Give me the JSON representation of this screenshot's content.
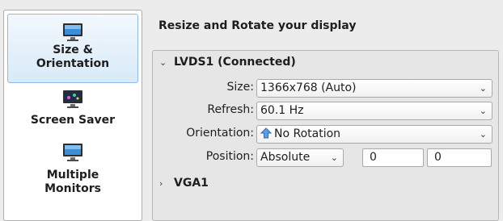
{
  "sidebar": {
    "items": [
      {
        "label_line1": "Size &",
        "label_line2": "Orientation",
        "icon": "monitor-icon"
      },
      {
        "label": "Screen Saver",
        "icon": "monitor-screensaver-icon"
      },
      {
        "label_line1": "Multiple",
        "label_line2": "Monitors",
        "icon": "monitor-icon"
      }
    ],
    "selected_index": 0
  },
  "main": {
    "title": "Resize and Rotate your display",
    "outputs": [
      {
        "name": "LVDS1 (Connected)",
        "expanded": true,
        "size_label": "Size:",
        "size_value": "1366x768 (Auto)",
        "refresh_label": "Refresh:",
        "refresh_value": "60.1 Hz",
        "orientation_label": "Orientation:",
        "orientation_value": "No Rotation",
        "position_label": "Position:",
        "position_mode": "Absolute",
        "position_x": "0",
        "position_y": "0"
      },
      {
        "name": "VGA1",
        "expanded": false
      }
    ]
  },
  "colors": {
    "selection_bg": "#d8eaf8",
    "selection_border": "#8fbbe3",
    "window_bg": "#ececec"
  }
}
